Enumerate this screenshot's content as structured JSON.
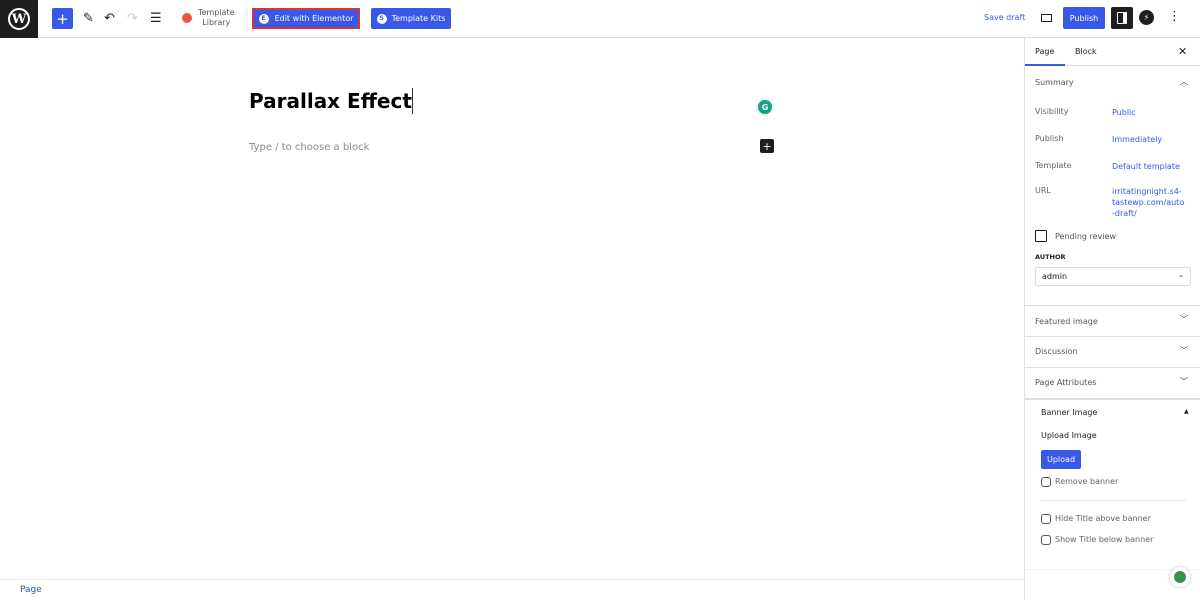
{
  "toolbar": {
    "logo_glyph": "W",
    "inserter_glyph": "+",
    "edit_glyph": "✎",
    "undo_glyph": "↶",
    "redo_glyph": "↷",
    "list_view_glyph": "☰",
    "template_library_label": "Template Library",
    "template_library_line1": "Template",
    "template_library_line2": "Library",
    "edit_elementor_label": "Edit with Elementor",
    "edit_elementor_glyph": "E",
    "template_kits_label": "Template Kits",
    "template_kits_glyph": "S",
    "save_draft_label": "Save draft",
    "publish_label": "Publish",
    "bolt_glyph": "⚡",
    "more_glyph": "⋮",
    "accent_color": "#3858e9"
  },
  "editor": {
    "title": "Parallax Effect",
    "block_placeholder": "Type / to choose a block",
    "grammarly_glyph": "G",
    "add_block_glyph": "+"
  },
  "footer": {
    "breadcrumb": "Page"
  },
  "sidebar": {
    "tabs": [
      {
        "label": "Page",
        "active": true
      },
      {
        "label": "Block",
        "active": false
      }
    ],
    "close_glyph": "✕",
    "summary": {
      "title": "Summary",
      "rows": [
        {
          "label": "Visibility",
          "value": "Public"
        },
        {
          "label": "Publish",
          "value": "Immediately"
        },
        {
          "label": "Template",
          "value": "Default template"
        },
        {
          "label": "URL",
          "value_lines": [
            "irritatingnight.s4-",
            "tastewp.com/auto",
            "-draft/"
          ]
        }
      ],
      "pending_review_label": "Pending review",
      "pending_review_checked": false,
      "author_label": "AUTHOR",
      "author_value": "admin"
    },
    "panels": [
      {
        "title": "Featured image",
        "expanded": false
      },
      {
        "title": "Discussion",
        "expanded": false
      },
      {
        "title": "Page Attributes",
        "expanded": false
      }
    ],
    "banner": {
      "title": "Banner Image",
      "upload_image_label": "Upload Image",
      "upload_button": "Upload",
      "remove_banner_label": "Remove banner",
      "hide_title_label": "Hide Title above banner",
      "show_title_label": "Show Title below banner"
    }
  }
}
